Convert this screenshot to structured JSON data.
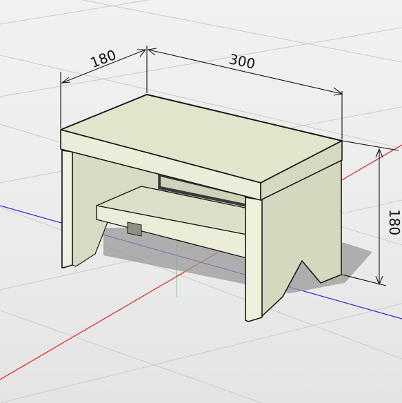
{
  "dimensions": {
    "depth": "180",
    "width": "300",
    "height": "180"
  },
  "colors": {
    "background": "#ececec",
    "grid": "#c9c9c9",
    "axis_red": "#e02020",
    "axis_blue": "#2b2bd8",
    "axis_green": "#22aa22",
    "wood_top": "#e4e6cf",
    "wood_front": "#ecedd8",
    "wood_side": "#d3d5bd",
    "shadow": "#9a9a9a",
    "outline": "#1a1a1a"
  }
}
